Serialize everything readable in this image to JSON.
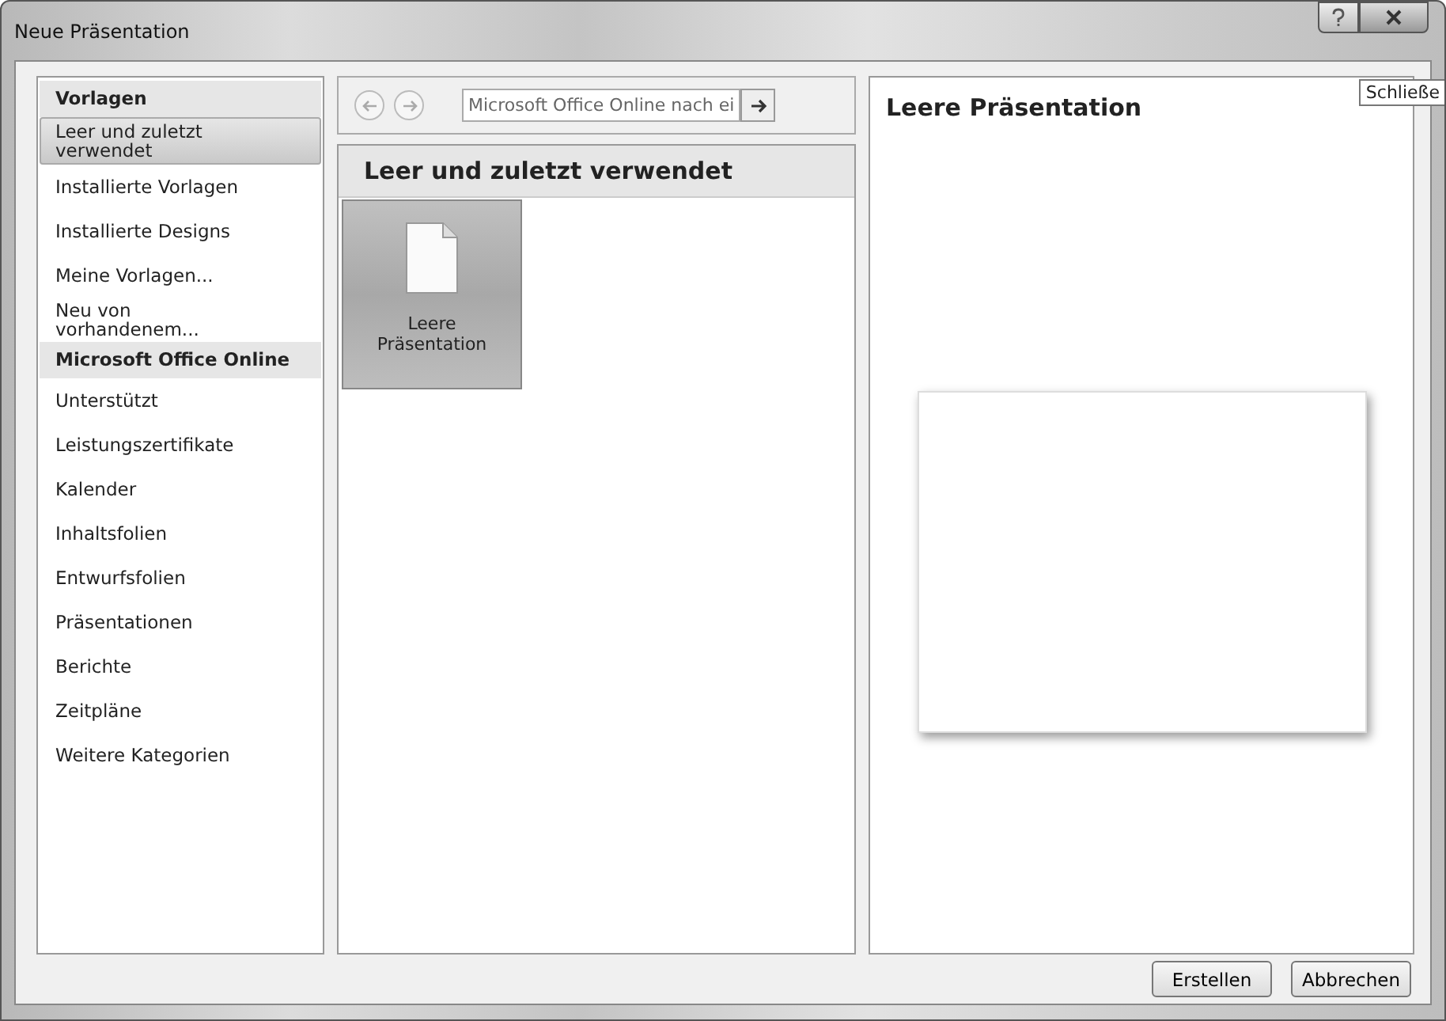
{
  "window": {
    "title": "Neue Präsentation",
    "tooltip": "Schließe"
  },
  "sidebar": {
    "sections": [
      {
        "header": "Vorlagen",
        "items": [
          {
            "label": "Leer und zuletzt verwendet",
            "selected": true
          },
          {
            "label": "Installierte Vorlagen",
            "selected": false
          },
          {
            "label": "Installierte Designs",
            "selected": false
          },
          {
            "label": "Meine Vorlagen...",
            "selected": false
          },
          {
            "label": "Neu von vorhandenem...",
            "selected": false
          }
        ]
      },
      {
        "header": "Microsoft Office Online",
        "items": [
          {
            "label": "Unterstützt",
            "selected": false
          },
          {
            "label": "Leistungszertifikate",
            "selected": false
          },
          {
            "label": "Kalender",
            "selected": false
          },
          {
            "label": "Inhaltsfolien",
            "selected": false
          },
          {
            "label": "Entwurfsfolien",
            "selected": false
          },
          {
            "label": "Präsentationen",
            "selected": false
          },
          {
            "label": "Berichte",
            "selected": false
          },
          {
            "label": "Zeitpläne",
            "selected": false
          },
          {
            "label": "Weitere Kategorien",
            "selected": false
          }
        ]
      }
    ]
  },
  "search": {
    "placeholder": "Microsoft Office Online nach ei"
  },
  "gallery": {
    "title": "Leer und zuletzt verwendet",
    "items": [
      {
        "label": "Leere Präsentation",
        "selected": true
      }
    ]
  },
  "preview": {
    "title": "Leere Präsentation"
  },
  "buttons": [
    "Erstellen",
    "Abbrechen"
  ]
}
